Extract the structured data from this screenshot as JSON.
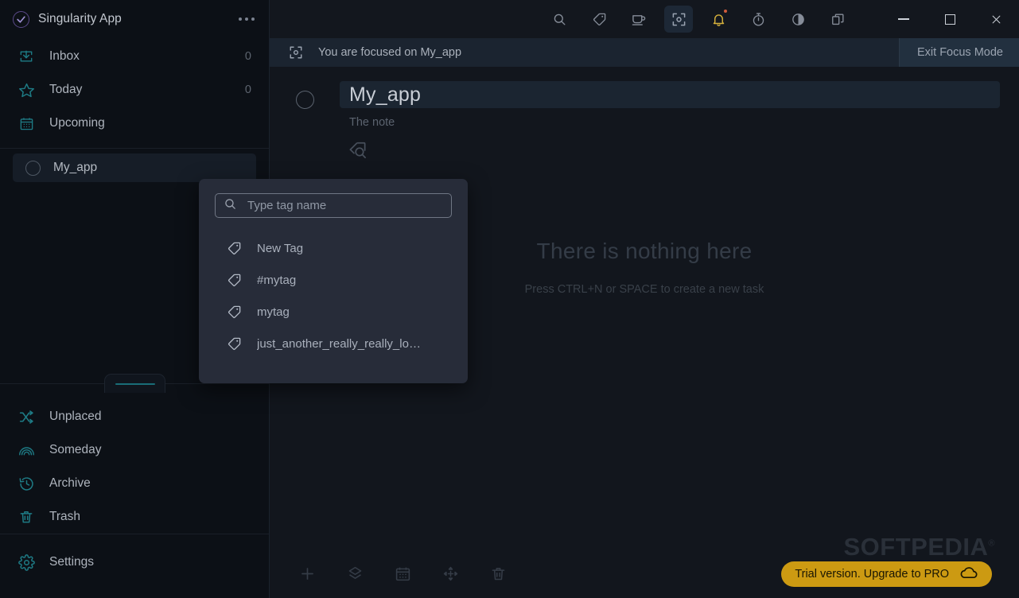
{
  "app": {
    "brand": "Singularity App",
    "overflow_menu": "more-options"
  },
  "sidebar": {
    "nav": [
      {
        "label": "Inbox",
        "count": "0",
        "icon": "inbox-icon"
      },
      {
        "label": "Today",
        "count": "0",
        "icon": "star-icon"
      },
      {
        "label": "Upcoming",
        "count": "",
        "icon": "calendar-icon"
      }
    ],
    "projects": [
      {
        "label": "My_app",
        "icon": "circle-icon",
        "selected": true
      }
    ],
    "utility": [
      {
        "label": "Unplaced",
        "icon": "shuffle-icon"
      },
      {
        "label": "Someday",
        "icon": "rainbow-icon"
      },
      {
        "label": "Archive",
        "icon": "history-icon"
      },
      {
        "label": "Trash",
        "icon": "trash-icon"
      }
    ],
    "settings": {
      "label": "Settings",
      "icon": "gear-icon"
    }
  },
  "toolbar": {
    "icons": [
      {
        "name": "search-icon",
        "label": "Search"
      },
      {
        "name": "tag-icon",
        "label": "Tags"
      },
      {
        "name": "coffee-icon",
        "label": "Break"
      },
      {
        "name": "focus-icon",
        "label": "Focus Mode"
      },
      {
        "name": "bell-icon",
        "label": "Notifications"
      },
      {
        "name": "timer-icon",
        "label": "Timer"
      },
      {
        "name": "contrast-icon",
        "label": "Theme"
      },
      {
        "name": "windows-icon",
        "label": "Windows"
      }
    ]
  },
  "window_controls": {
    "minimize": "minimize",
    "maximize": "maximize",
    "close": "close"
  },
  "focus_banner": {
    "text": "You are focused on My_app",
    "exit_label": "Exit Focus Mode"
  },
  "task": {
    "title": "My_app",
    "note": "The note"
  },
  "empty_state": {
    "title": "There is nothing here",
    "subtitle": "Press CTRL+N or SPACE to create a new task"
  },
  "bottom_toolbar": [
    {
      "name": "add-icon",
      "label": "Add"
    },
    {
      "name": "layers-icon",
      "label": "Layers"
    },
    {
      "name": "calendar-icon",
      "label": "Schedule"
    },
    {
      "name": "move-icon",
      "label": "Move"
    },
    {
      "name": "trash-icon",
      "label": "Delete"
    }
  ],
  "tag_popup": {
    "search_placeholder": "Type tag name",
    "search_value": "",
    "items": [
      {
        "label": "New Tag"
      },
      {
        "label": "#mytag"
      },
      {
        "label": "mytag"
      },
      {
        "label": "just_another_really_really_lo…"
      }
    ]
  },
  "watermark": {
    "text": "SOFTPEDIA",
    "registered": "®"
  },
  "trial": {
    "label": "Trial version. Upgrade to PRO"
  },
  "colors": {
    "accent_teal": "#1e7b85",
    "trial_gold": "#cc9a12",
    "bell_gold": "#d7b23c",
    "sidebar_bg": "#0c1016",
    "main_bg": "#12161d",
    "popup_bg": "#272c39"
  }
}
